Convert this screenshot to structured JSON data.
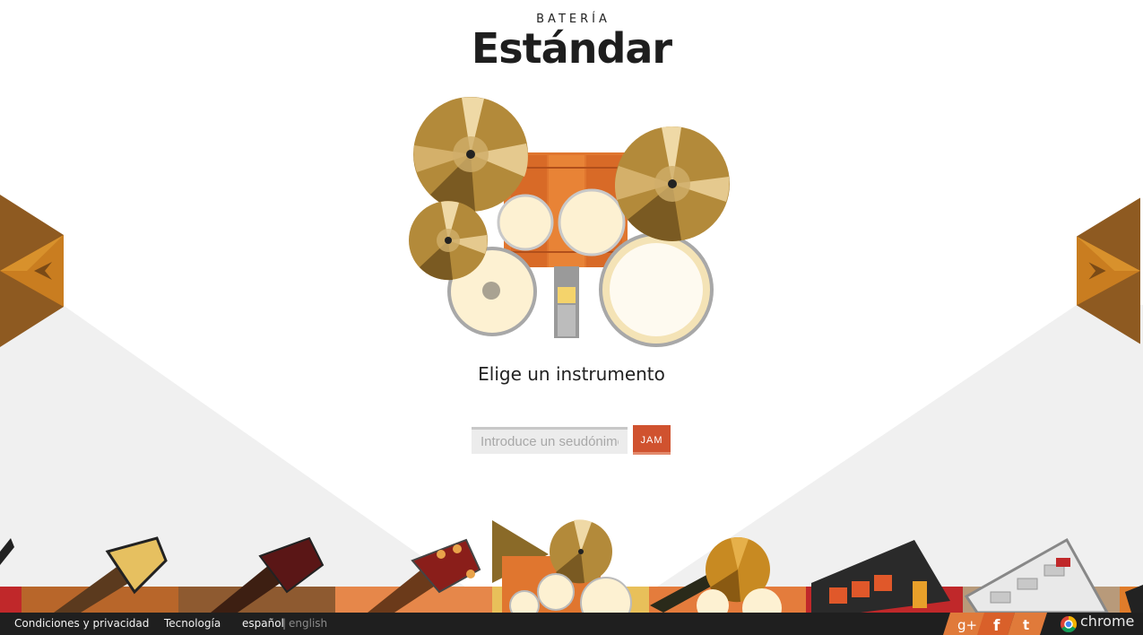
{
  "header": {
    "kicker": "BATERÍA",
    "title": "Estándar"
  },
  "main": {
    "subtitle": "Elige un instrumento",
    "nickname_placeholder": "Introduce un seudónimo.",
    "jam_label": "JAM"
  },
  "footer": {
    "links": {
      "privacy": "Condiciones y privacidad",
      "tech": "Tecnología",
      "lang_es": "español",
      "separator": "|",
      "lang_en": "english"
    },
    "brand": "chrome"
  },
  "colors": {
    "accent": "#d0522f",
    "cymbal": "#b38a3a",
    "drum_shell": "#e0762f",
    "drum_head": "#fdf1d2",
    "footer_bg": "#1f1f1f"
  },
  "icons": {
    "left_arrow": "chevron-left-icon",
    "right_arrow": "chevron-right-icon",
    "gplus": "google-plus-icon",
    "facebook": "facebook-icon",
    "twitter": "twitter-icon",
    "chrome": "chrome-logo-icon"
  }
}
